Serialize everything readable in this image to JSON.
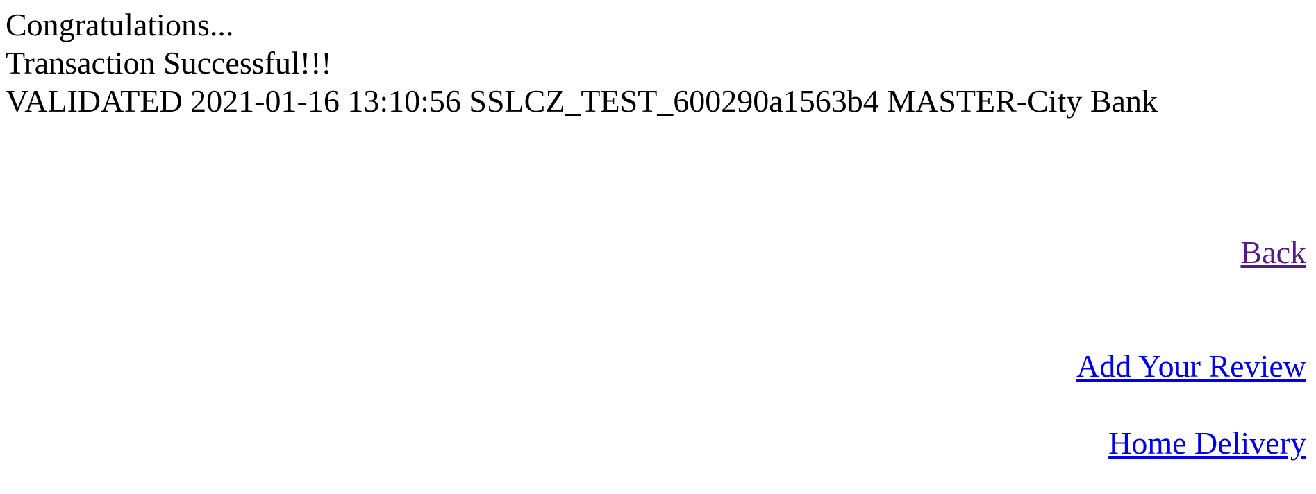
{
  "status": {
    "congratulations": "Congratulations...",
    "result": "Transaction Successful!!!",
    "details": "VALIDATED 2021-01-16 13:10:56 SSLCZ_TEST_600290a1563b4 MASTER-City Bank"
  },
  "links": {
    "back": "Back",
    "add_review": "Add Your Review",
    "home_delivery": "Home Delivery"
  },
  "colors": {
    "text": "#000000",
    "link": "#0000ee",
    "visited_link": "#551a8b",
    "background": "#ffffff"
  }
}
